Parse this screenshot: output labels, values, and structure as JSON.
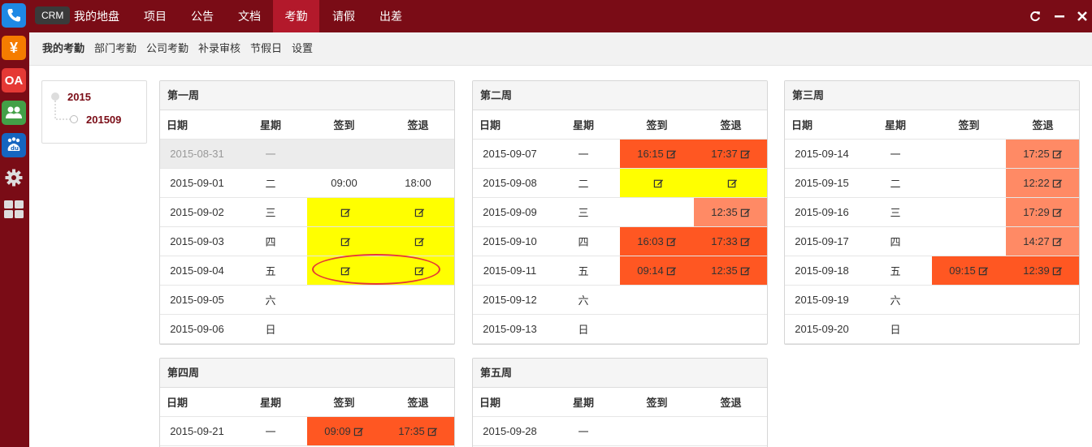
{
  "topnav": {
    "crm": "CRM",
    "items": [
      "我的地盘",
      "项目",
      "公告",
      "文档",
      "考勤",
      "请假",
      "出差"
    ],
    "active": "考勤"
  },
  "subnav": {
    "items": [
      "我的考勤",
      "部门考勤",
      "公司考勤",
      "补录审核",
      "节假日",
      "设置"
    ],
    "active": "我的考勤"
  },
  "rail": [
    "phone-icon",
    "yen-icon",
    "OA",
    "people-icon",
    "baidu-icon",
    "gear-icon",
    "apps-grid-icon"
  ],
  "tree": {
    "year": "2015",
    "month": "201509"
  },
  "columns": [
    "日期",
    "星期",
    "签到",
    "签退"
  ],
  "colors": {
    "yellow": "#ffff00",
    "red": "#ff5722",
    "salmon": "#ff8a65",
    "brand": "#7a0c16",
    "active_tab": "#b3192b"
  },
  "weeks": [
    {
      "title": "第一周",
      "rows": [
        {
          "date": "2015-08-31",
          "weekday": "一",
          "grey": true,
          "in": null,
          "out": null
        },
        {
          "date": "2015-09-01",
          "weekday": "二",
          "in": {
            "time": "09:00"
          },
          "out": {
            "time": "18:00"
          }
        },
        {
          "date": "2015-09-02",
          "weekday": "三",
          "in": {
            "time": "",
            "color": "yellow",
            "edit": true
          },
          "out": {
            "time": "",
            "color": "yellow",
            "edit": true
          }
        },
        {
          "date": "2015-09-03",
          "weekday": "四",
          "in": {
            "time": "",
            "color": "yellow",
            "edit": true
          },
          "out": {
            "time": "",
            "color": "yellow",
            "edit": true
          }
        },
        {
          "date": "2015-09-04",
          "weekday": "五",
          "in": {
            "time": "",
            "color": "yellow",
            "edit": true
          },
          "out": {
            "time": "",
            "color": "yellow",
            "edit": true
          }
        },
        {
          "date": "2015-09-05",
          "weekday": "六",
          "in": null,
          "out": null
        },
        {
          "date": "2015-09-06",
          "weekday": "日",
          "in": null,
          "out": null
        }
      ]
    },
    {
      "title": "第二周",
      "rows": [
        {
          "date": "2015-09-07",
          "weekday": "一",
          "in": {
            "time": "16:15",
            "color": "red",
            "edit": true
          },
          "out": {
            "time": "17:37",
            "color": "red",
            "edit": true
          }
        },
        {
          "date": "2015-09-08",
          "weekday": "二",
          "in": {
            "time": "",
            "color": "yellow",
            "edit": true
          },
          "out": {
            "time": "",
            "color": "yellow",
            "edit": true
          }
        },
        {
          "date": "2015-09-09",
          "weekday": "三",
          "in": null,
          "out": {
            "time": "12:35",
            "color": "salmon",
            "edit": true
          }
        },
        {
          "date": "2015-09-10",
          "weekday": "四",
          "in": {
            "time": "16:03",
            "color": "red",
            "edit": true
          },
          "out": {
            "time": "17:33",
            "color": "red",
            "edit": true
          }
        },
        {
          "date": "2015-09-11",
          "weekday": "五",
          "in": {
            "time": "09:14",
            "color": "red",
            "edit": true
          },
          "out": {
            "time": "12:35",
            "color": "red",
            "edit": true
          }
        },
        {
          "date": "2015-09-12",
          "weekday": "六",
          "in": null,
          "out": null
        },
        {
          "date": "2015-09-13",
          "weekday": "日",
          "in": null,
          "out": null
        }
      ]
    },
    {
      "title": "第三周",
      "rows": [
        {
          "date": "2015-09-14",
          "weekday": "一",
          "in": null,
          "out": {
            "time": "17:25",
            "color": "salmon",
            "edit": true
          }
        },
        {
          "date": "2015-09-15",
          "weekday": "二",
          "in": null,
          "out": {
            "time": "12:22",
            "color": "salmon",
            "edit": true
          }
        },
        {
          "date": "2015-09-16",
          "weekday": "三",
          "in": null,
          "out": {
            "time": "17:29",
            "color": "salmon",
            "edit": true
          }
        },
        {
          "date": "2015-09-17",
          "weekday": "四",
          "in": null,
          "out": {
            "time": "14:27",
            "color": "salmon",
            "edit": true
          }
        },
        {
          "date": "2015-09-18",
          "weekday": "五",
          "in": {
            "time": "09:15",
            "color": "red",
            "edit": true
          },
          "out": {
            "time": "12:39",
            "color": "red",
            "edit": true
          }
        },
        {
          "date": "2015-09-19",
          "weekday": "六",
          "in": null,
          "out": null
        },
        {
          "date": "2015-09-20",
          "weekday": "日",
          "in": null,
          "out": null
        }
      ]
    },
    {
      "title": "第四周",
      "rows": [
        {
          "date": "2015-09-21",
          "weekday": "一",
          "in": {
            "time": "09:09",
            "color": "red",
            "edit": true
          },
          "out": {
            "time": "17:35",
            "color": "red",
            "edit": true
          }
        }
      ]
    },
    {
      "title": "第五周",
      "rows": [
        {
          "date": "2015-09-28",
          "weekday": "一",
          "in": null,
          "out": null
        }
      ]
    }
  ]
}
